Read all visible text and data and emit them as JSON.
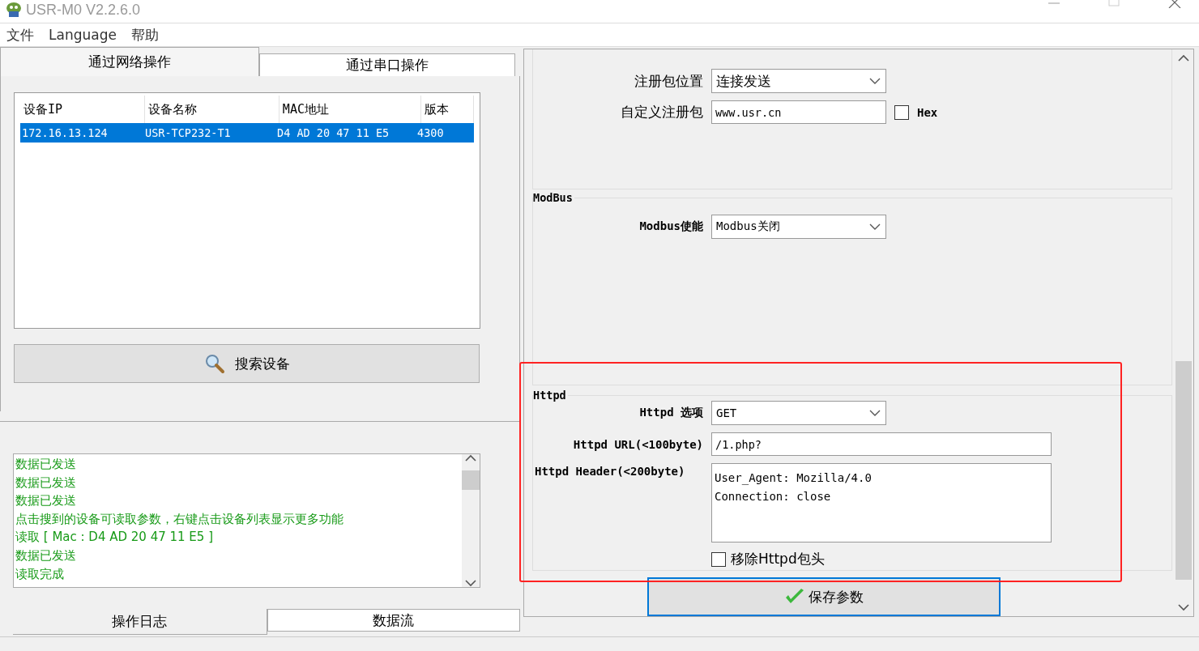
{
  "window": {
    "title": "USR-M0 V2.2.6.0"
  },
  "menu": [
    "文件",
    "Language",
    "帮助"
  ],
  "left_tabs": [
    {
      "label": "通过网络操作",
      "selected": true
    },
    {
      "label": "通过串口操作",
      "selected": false
    }
  ],
  "device_table": {
    "columns": [
      "设备IP",
      "设备名称",
      "MAC地址",
      "版本"
    ],
    "rows": [
      {
        "cells": [
          "172.16.13.124",
          "USR-TCP232-T1",
          "D4 AD 20 47 11 E5",
          "4300"
        ],
        "selected": true
      }
    ]
  },
  "search_button": "搜索设备",
  "log": [
    "数据已发送",
    "数据已发送",
    "数据已发送",
    "点击搜到的设备可读取参数，右键点击设备列表显示更多功能",
    "读取 [ Mac : D4 AD 20 47 11 E5 ]",
    "数据已发送",
    "读取完成"
  ],
  "bottom_tabs": [
    {
      "label": "操作日志",
      "selected": true
    },
    {
      "label": "数据流",
      "selected": false
    }
  ],
  "register": {
    "rows": [
      {
        "kind": "select",
        "label": "注册包位置",
        "value": "连接发送"
      },
      {
        "kind": "text",
        "label": "自定义注册包",
        "value": "www.usr.cn",
        "checkbox": {
          "label": "Hex",
          "checked": false
        }
      }
    ]
  },
  "modbus": {
    "title": "ModBus",
    "rows": [
      {
        "kind": "select",
        "label": "Modbus使能",
        "value": "Modbus关闭"
      }
    ]
  },
  "httpd": {
    "title": "Httpd",
    "rows": [
      {
        "kind": "select",
        "label": "Httpd 选项",
        "value": "GET"
      },
      {
        "kind": "wide",
        "label": "Httpd URL(<100byte)",
        "value": "/1.php?"
      },
      {
        "kind": "area",
        "label": "Httpd Header(<200byte)",
        "value": "User_Agent: Mozilla/4.0\nConnection: close"
      }
    ],
    "checkbox": {
      "label": "移除Httpd包头",
      "checked": false
    }
  },
  "save_button": "保存参数"
}
